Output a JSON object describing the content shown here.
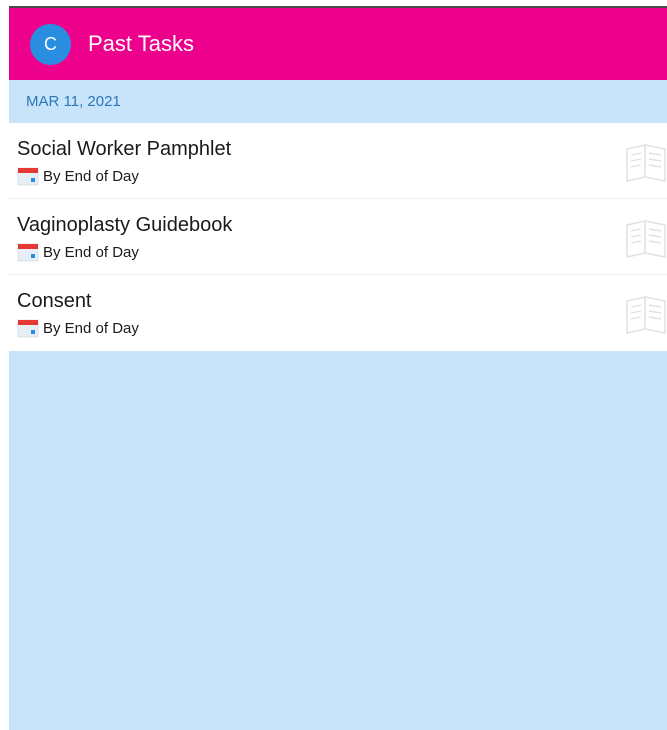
{
  "header": {
    "avatar_letter": "C",
    "title": "Past Tasks",
    "color": "#ec008c",
    "avatar_color": "#2a8ee0"
  },
  "section": {
    "date": "MAR 11, 2021",
    "background": "#c7e4fa"
  },
  "tasks": [
    {
      "title": "Social Worker Pamphlet",
      "due": "By End of Day",
      "icon": "calendar-icon",
      "trailing_icon": "open-book-icon"
    },
    {
      "title": "Vaginoplasty Guidebook",
      "due": "By End of Day",
      "icon": "calendar-icon",
      "trailing_icon": "open-book-icon"
    },
    {
      "title": "Consent",
      "due": "By End of Day",
      "icon": "calendar-icon",
      "trailing_icon": "open-book-icon"
    }
  ]
}
